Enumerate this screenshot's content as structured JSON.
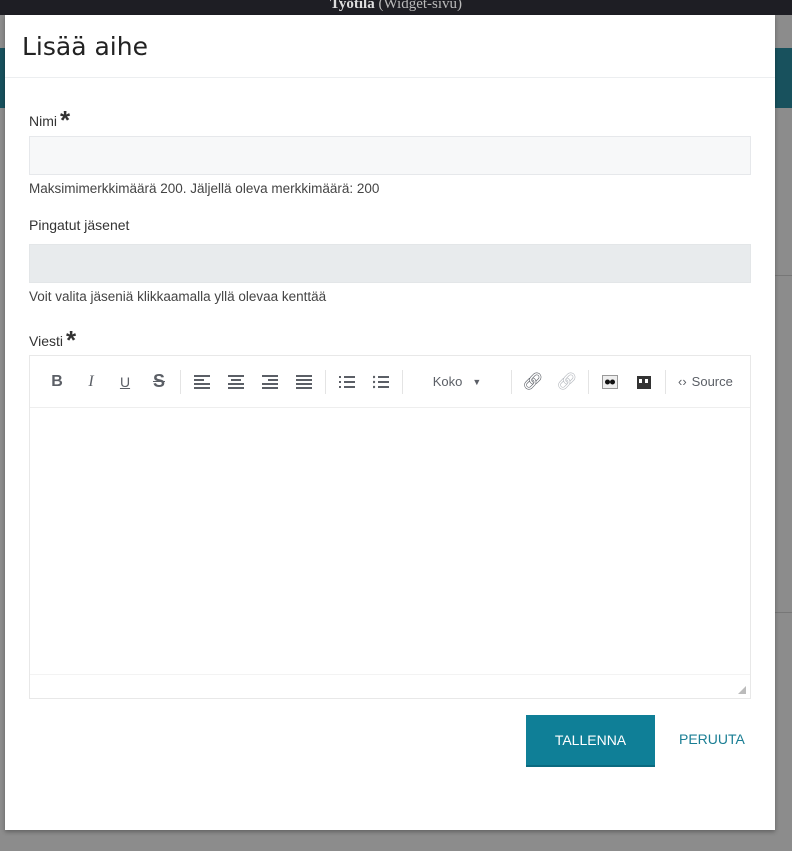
{
  "background": {
    "title": "Työtila",
    "subtitle": "(Widget-sivu)"
  },
  "modal": {
    "title": "Lisää aihe",
    "name_label": "Nimi",
    "required_mark": "*",
    "name_value": "",
    "name_help": "Maksimimerkkimäärä 200. Jäljellä oleva merkkimäärä: 200",
    "members_label": "Pingatut jäsenet",
    "members_value": "",
    "members_help": "Voit valita jäseniä klikkaamalla yllä olevaa kenttää",
    "message_label": "Viesti",
    "toolbar": {
      "bold": "B",
      "italic": "I",
      "underline": "U",
      "strike": "S",
      "size": "Koko",
      "source": "Source"
    },
    "save_label": "TALLENNA",
    "cancel_label": "PERUUTA"
  },
  "colors": {
    "accent": "#0f7f97",
    "link": "#1a7e94"
  }
}
